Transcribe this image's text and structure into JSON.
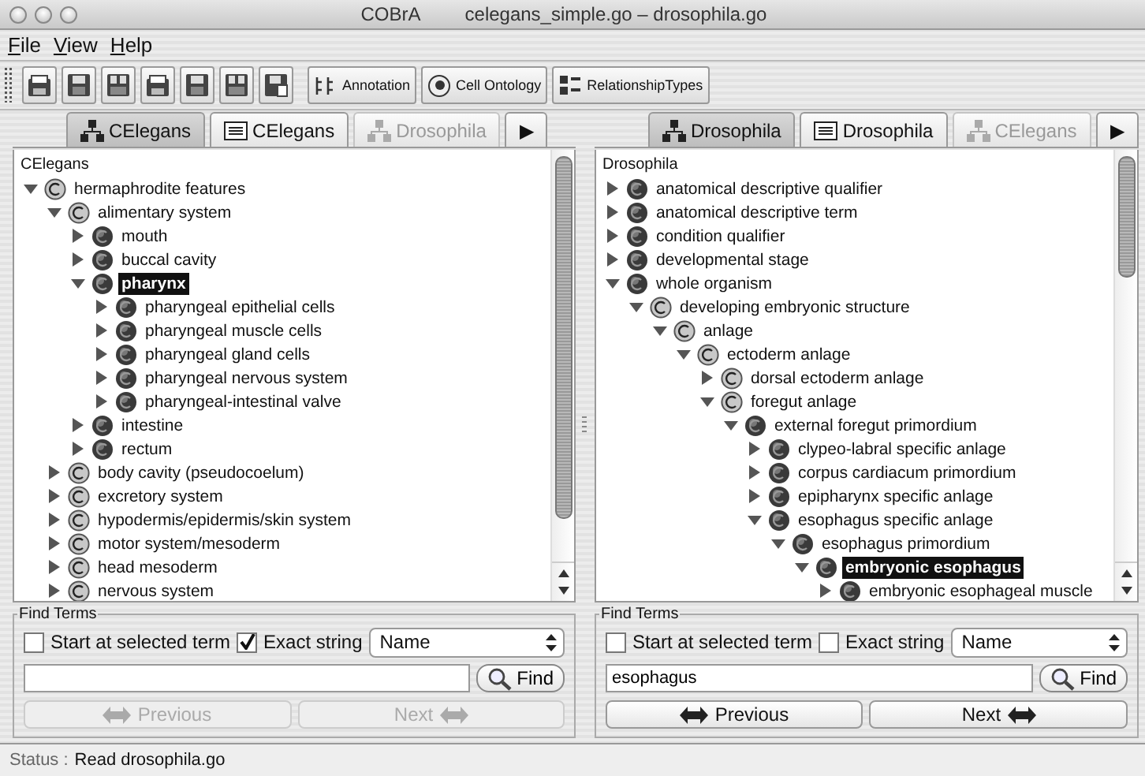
{
  "window": {
    "title_app": "COBrA",
    "title_files": "celegans_simple.go – drosophila.go"
  },
  "menu": [
    "File",
    "View",
    "Help"
  ],
  "toolbar": {
    "icon_buttons": [
      {
        "kind": "open"
      },
      {
        "kind": "save"
      },
      {
        "kind": "save_all"
      },
      {
        "kind": "open"
      },
      {
        "kind": "save"
      },
      {
        "kind": "save_all"
      },
      {
        "kind": "save_as"
      }
    ],
    "buttons": [
      {
        "label": "Annotation",
        "kind": "annotation"
      },
      {
        "label": "Cell Ontology",
        "kind": "cell"
      },
      {
        "label": "RelationshipTypes",
        "kind": "relations"
      }
    ]
  },
  "panes": [
    {
      "tabs": [
        {
          "label": "CElegans",
          "kind": "tree",
          "selected": true,
          "disabled": false
        },
        {
          "label": "CElegans",
          "kind": "list",
          "selected": false,
          "disabled": false
        },
        {
          "label": "Drosophila",
          "kind": "tree",
          "selected": false,
          "disabled": true
        },
        {
          "label": "▶",
          "kind": "arrow",
          "selected": false,
          "disabled": false
        }
      ],
      "tree": {
        "root": "CElegans",
        "nodes": [
          {
            "label": "hermaphrodite features",
            "filled": false,
            "expanded": true,
            "selected": false,
            "children": [
              {
                "label": "alimentary system",
                "filled": false,
                "expanded": true,
                "selected": false,
                "children": [
                  {
                    "label": "mouth",
                    "filled": true,
                    "expanded": false,
                    "selected": false
                  },
                  {
                    "label": "buccal cavity",
                    "filled": true,
                    "expanded": false,
                    "selected": false
                  },
                  {
                    "label": "pharynx",
                    "filled": true,
                    "expanded": true,
                    "selected": true,
                    "children": [
                      {
                        "label": "pharyngeal epithelial cells",
                        "filled": true,
                        "expanded": false,
                        "selected": false
                      },
                      {
                        "label": "pharyngeal muscle cells",
                        "filled": true,
                        "expanded": false,
                        "selected": false
                      },
                      {
                        "label": "pharyngeal gland cells",
                        "filled": true,
                        "expanded": false,
                        "selected": false
                      },
                      {
                        "label": "pharyngeal nervous system",
                        "filled": true,
                        "expanded": false,
                        "selected": false
                      },
                      {
                        "label": "pharyngeal-intestinal valve",
                        "filled": true,
                        "expanded": false,
                        "selected": false
                      }
                    ]
                  },
                  {
                    "label": "intestine",
                    "filled": true,
                    "expanded": false,
                    "selected": false
                  },
                  {
                    "label": "rectum",
                    "filled": true,
                    "expanded": false,
                    "selected": false
                  }
                ]
              },
              {
                "label": "body cavity (pseudocoelum)",
                "filled": false,
                "expanded": false,
                "selected": false
              },
              {
                "label": "excretory system",
                "filled": false,
                "expanded": false,
                "selected": false
              },
              {
                "label": "hypodermis/epidermis/skin system",
                "filled": false,
                "expanded": false,
                "selected": false
              },
              {
                "label": "motor system/mesoderm",
                "filled": false,
                "expanded": false,
                "selected": false
              },
              {
                "label": "head mesoderm",
                "filled": false,
                "expanded": false,
                "selected": false
              },
              {
                "label": "nervous system",
                "filled": false,
                "expanded": false,
                "selected": false
              }
            ]
          }
        ]
      },
      "find": {
        "title": "Find Terms",
        "start_at_selected": {
          "label": "Start at selected term",
          "checked": false
        },
        "exact_string": {
          "label": "Exact string",
          "checked": true
        },
        "field": "Name",
        "find_button": "Find",
        "previous": {
          "label": "Previous",
          "disabled": true
        },
        "next": {
          "label": "Next",
          "disabled": true
        }
      }
    },
    {
      "tabs": [
        {
          "label": "Drosophila",
          "kind": "tree",
          "selected": true,
          "disabled": false
        },
        {
          "label": "Drosophila",
          "kind": "list",
          "selected": false,
          "disabled": false
        },
        {
          "label": "CElegans",
          "kind": "tree",
          "selected": false,
          "disabled": true
        },
        {
          "label": "▶",
          "kind": "arrow",
          "selected": false,
          "disabled": false
        }
      ],
      "tree": {
        "root": "Drosophila",
        "nodes": [
          {
            "label": "anatomical descriptive qualifier",
            "filled": true,
            "expanded": false,
            "selected": false
          },
          {
            "label": "anatomical descriptive term",
            "filled": true,
            "expanded": false,
            "selected": false
          },
          {
            "label": "condition qualifier",
            "filled": true,
            "expanded": false,
            "selected": false
          },
          {
            "label": "developmental stage",
            "filled": true,
            "expanded": false,
            "selected": false
          },
          {
            "label": "whole organism",
            "filled": true,
            "expanded": true,
            "selected": false,
            "children": [
              {
                "label": "developing embryonic structure",
                "filled": false,
                "expanded": true,
                "selected": false,
                "children": [
                  {
                    "label": "anlage",
                    "filled": false,
                    "expanded": true,
                    "selected": false,
                    "children": [
                      {
                        "label": "ectoderm anlage",
                        "filled": false,
                        "expanded": true,
                        "selected": false,
                        "children": [
                          {
                            "label": "dorsal ectoderm anlage",
                            "filled": false,
                            "expanded": false,
                            "selected": false
                          },
                          {
                            "label": "foregut anlage",
                            "filled": false,
                            "expanded": true,
                            "selected": false,
                            "children": [
                              {
                                "label": "external foregut primordium",
                                "filled": true,
                                "expanded": true,
                                "selected": false,
                                "children": [
                                  {
                                    "label": "clypeo-labral specific anlage",
                                    "filled": true,
                                    "expanded": false,
                                    "selected": false
                                  },
                                  {
                                    "label": "corpus cardiacum primordium",
                                    "filled": true,
                                    "expanded": false,
                                    "selected": false
                                  },
                                  {
                                    "label": "epipharynx specific anlage",
                                    "filled": true,
                                    "expanded": false,
                                    "selected": false
                                  },
                                  {
                                    "label": "esophagus specific anlage",
                                    "filled": true,
                                    "expanded": true,
                                    "selected": false,
                                    "children": [
                                      {
                                        "label": "esophagus primordium",
                                        "filled": true,
                                        "expanded": true,
                                        "selected": false,
                                        "children": [
                                          {
                                            "label": "embryonic esophagus",
                                            "filled": true,
                                            "expanded": true,
                                            "selected": true,
                                            "children": [
                                              {
                                                "label": "embryonic esophageal muscle",
                                                "filled": true,
                                                "expanded": false,
                                                "selected": false
                                              }
                                            ]
                                          }
                                        ]
                                      }
                                    ]
                                  }
                                ]
                              }
                            ]
                          }
                        ]
                      }
                    ]
                  }
                ]
              }
            ]
          }
        ]
      },
      "find": {
        "title": "Find Terms",
        "start_at_selected": {
          "label": "Start at selected term",
          "checked": false
        },
        "exact_string": {
          "label": "Exact string",
          "checked": false
        },
        "field": "Name",
        "query": "esophagus",
        "find_button": "Find",
        "previous": {
          "label": "Previous",
          "disabled": false
        },
        "next": {
          "label": "Next",
          "disabled": false
        }
      }
    }
  ],
  "status_bar": {
    "label": "Status :",
    "message": "Read drosophila.go"
  }
}
